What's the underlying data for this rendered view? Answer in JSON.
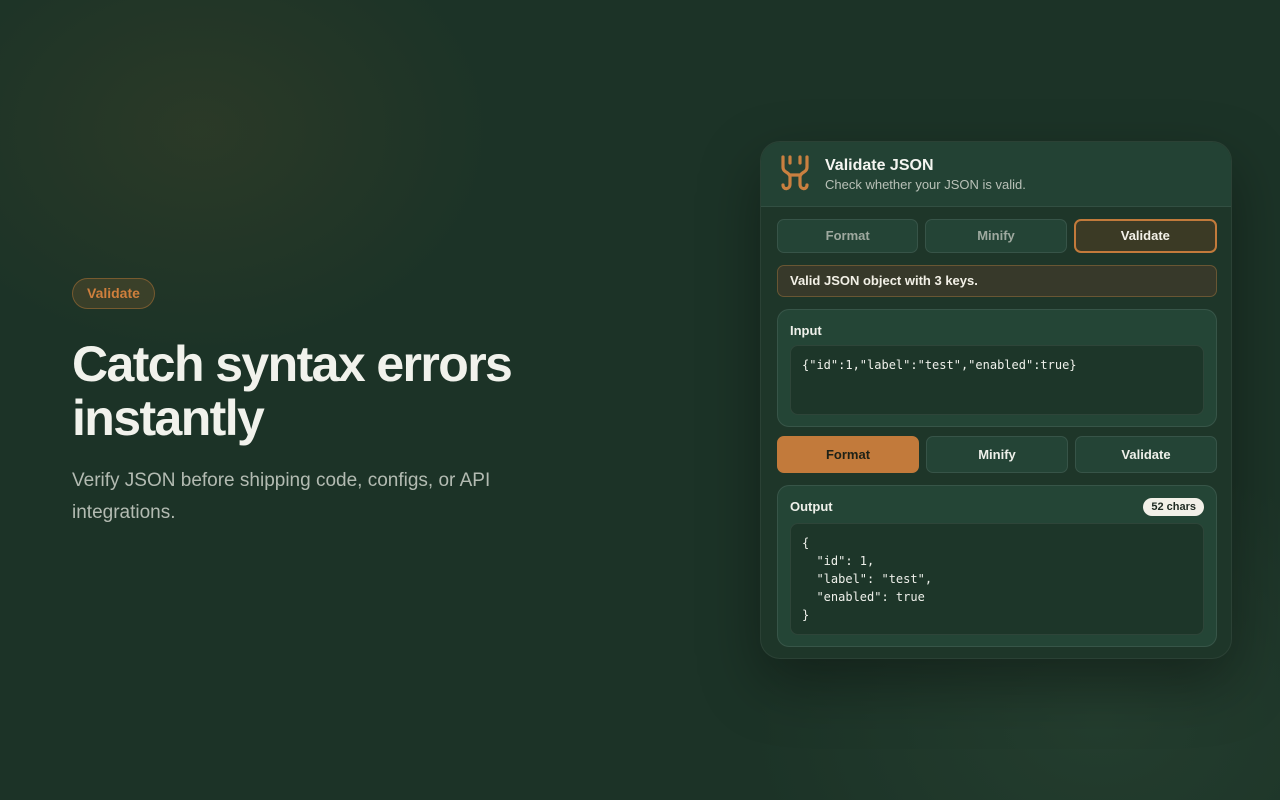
{
  "hero": {
    "badge": "Validate",
    "title": "Catch syntax errors instantly",
    "subtitle": "Verify JSON before shipping code, configs, or API integrations."
  },
  "card": {
    "title": "Validate JSON",
    "subtitle": "Check whether your JSON is valid.",
    "logo_icon": "brand-logo-icon",
    "tabs": [
      {
        "label": "Format",
        "active": false
      },
      {
        "label": "Minify",
        "active": false
      },
      {
        "label": "Validate",
        "active": true
      }
    ],
    "status": "Valid JSON object with 3 keys.",
    "input": {
      "label": "Input",
      "value": "{\"id\":1,\"label\":\"test\",\"enabled\":true}"
    },
    "actions": [
      {
        "label": "Format",
        "primary": true
      },
      {
        "label": "Minify",
        "primary": false
      },
      {
        "label": "Validate",
        "primary": false
      }
    ],
    "output": {
      "label": "Output",
      "count": "52 chars",
      "value": "{\n  \"id\": 1,\n  \"label\": \"test\",\n  \"enabled\": true\n}"
    }
  },
  "colors": {
    "background": "#1c3327",
    "accent": "#c27a3b",
    "card": "#1e3629",
    "panel": "#244536"
  }
}
